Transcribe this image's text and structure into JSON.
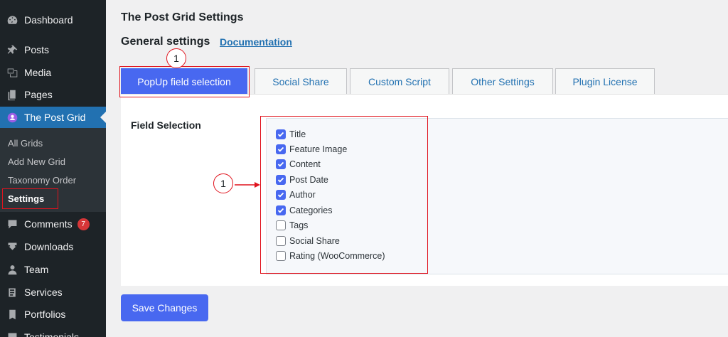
{
  "sidebar": {
    "items": [
      {
        "label": "Dashboard",
        "icon": "dashboard-icon"
      },
      {
        "label": "Posts",
        "icon": "pin-icon"
      },
      {
        "label": "Media",
        "icon": "media-icon"
      },
      {
        "label": "Pages",
        "icon": "pages-icon"
      },
      {
        "label": "The Post Grid",
        "icon": "post-grid-icon"
      },
      {
        "label": "Comments",
        "icon": "comment-icon",
        "badge": "7"
      },
      {
        "label": "Downloads",
        "icon": "download-icon"
      },
      {
        "label": "Team",
        "icon": "team-icon"
      },
      {
        "label": "Services",
        "icon": "services-icon"
      },
      {
        "label": "Portfolios",
        "icon": "portfolio-icon"
      },
      {
        "label": "Testimonials",
        "icon": "testimonial-icon"
      }
    ],
    "submenu": [
      "All Grids",
      "Add New Grid",
      "Taxonomy Order",
      "Settings"
    ]
  },
  "main": {
    "page_title": "The Post Grid Settings",
    "section_title": "General settings",
    "doc_link": "Documentation",
    "tabs": [
      "PopUp field selection",
      "Social Share",
      "Custom Script",
      "Other Settings",
      "Plugin License"
    ],
    "field_label": "Field Selection",
    "fields": [
      {
        "label": "Title",
        "checked": true
      },
      {
        "label": "Feature Image",
        "checked": true
      },
      {
        "label": "Content",
        "checked": true
      },
      {
        "label": "Post Date",
        "checked": true
      },
      {
        "label": "Author",
        "checked": true
      },
      {
        "label": "Categories",
        "checked": true
      },
      {
        "label": "Tags",
        "checked": false
      },
      {
        "label": "Social Share",
        "checked": false
      },
      {
        "label": "Rating (WooCommerce)",
        "checked": false
      }
    ],
    "save_label": "Save Changes"
  },
  "annotations": {
    "marker_label": "1"
  },
  "colors": {
    "accent": "#4868f0",
    "sidebar": "#1d2327",
    "annotation": "#e0141e"
  }
}
